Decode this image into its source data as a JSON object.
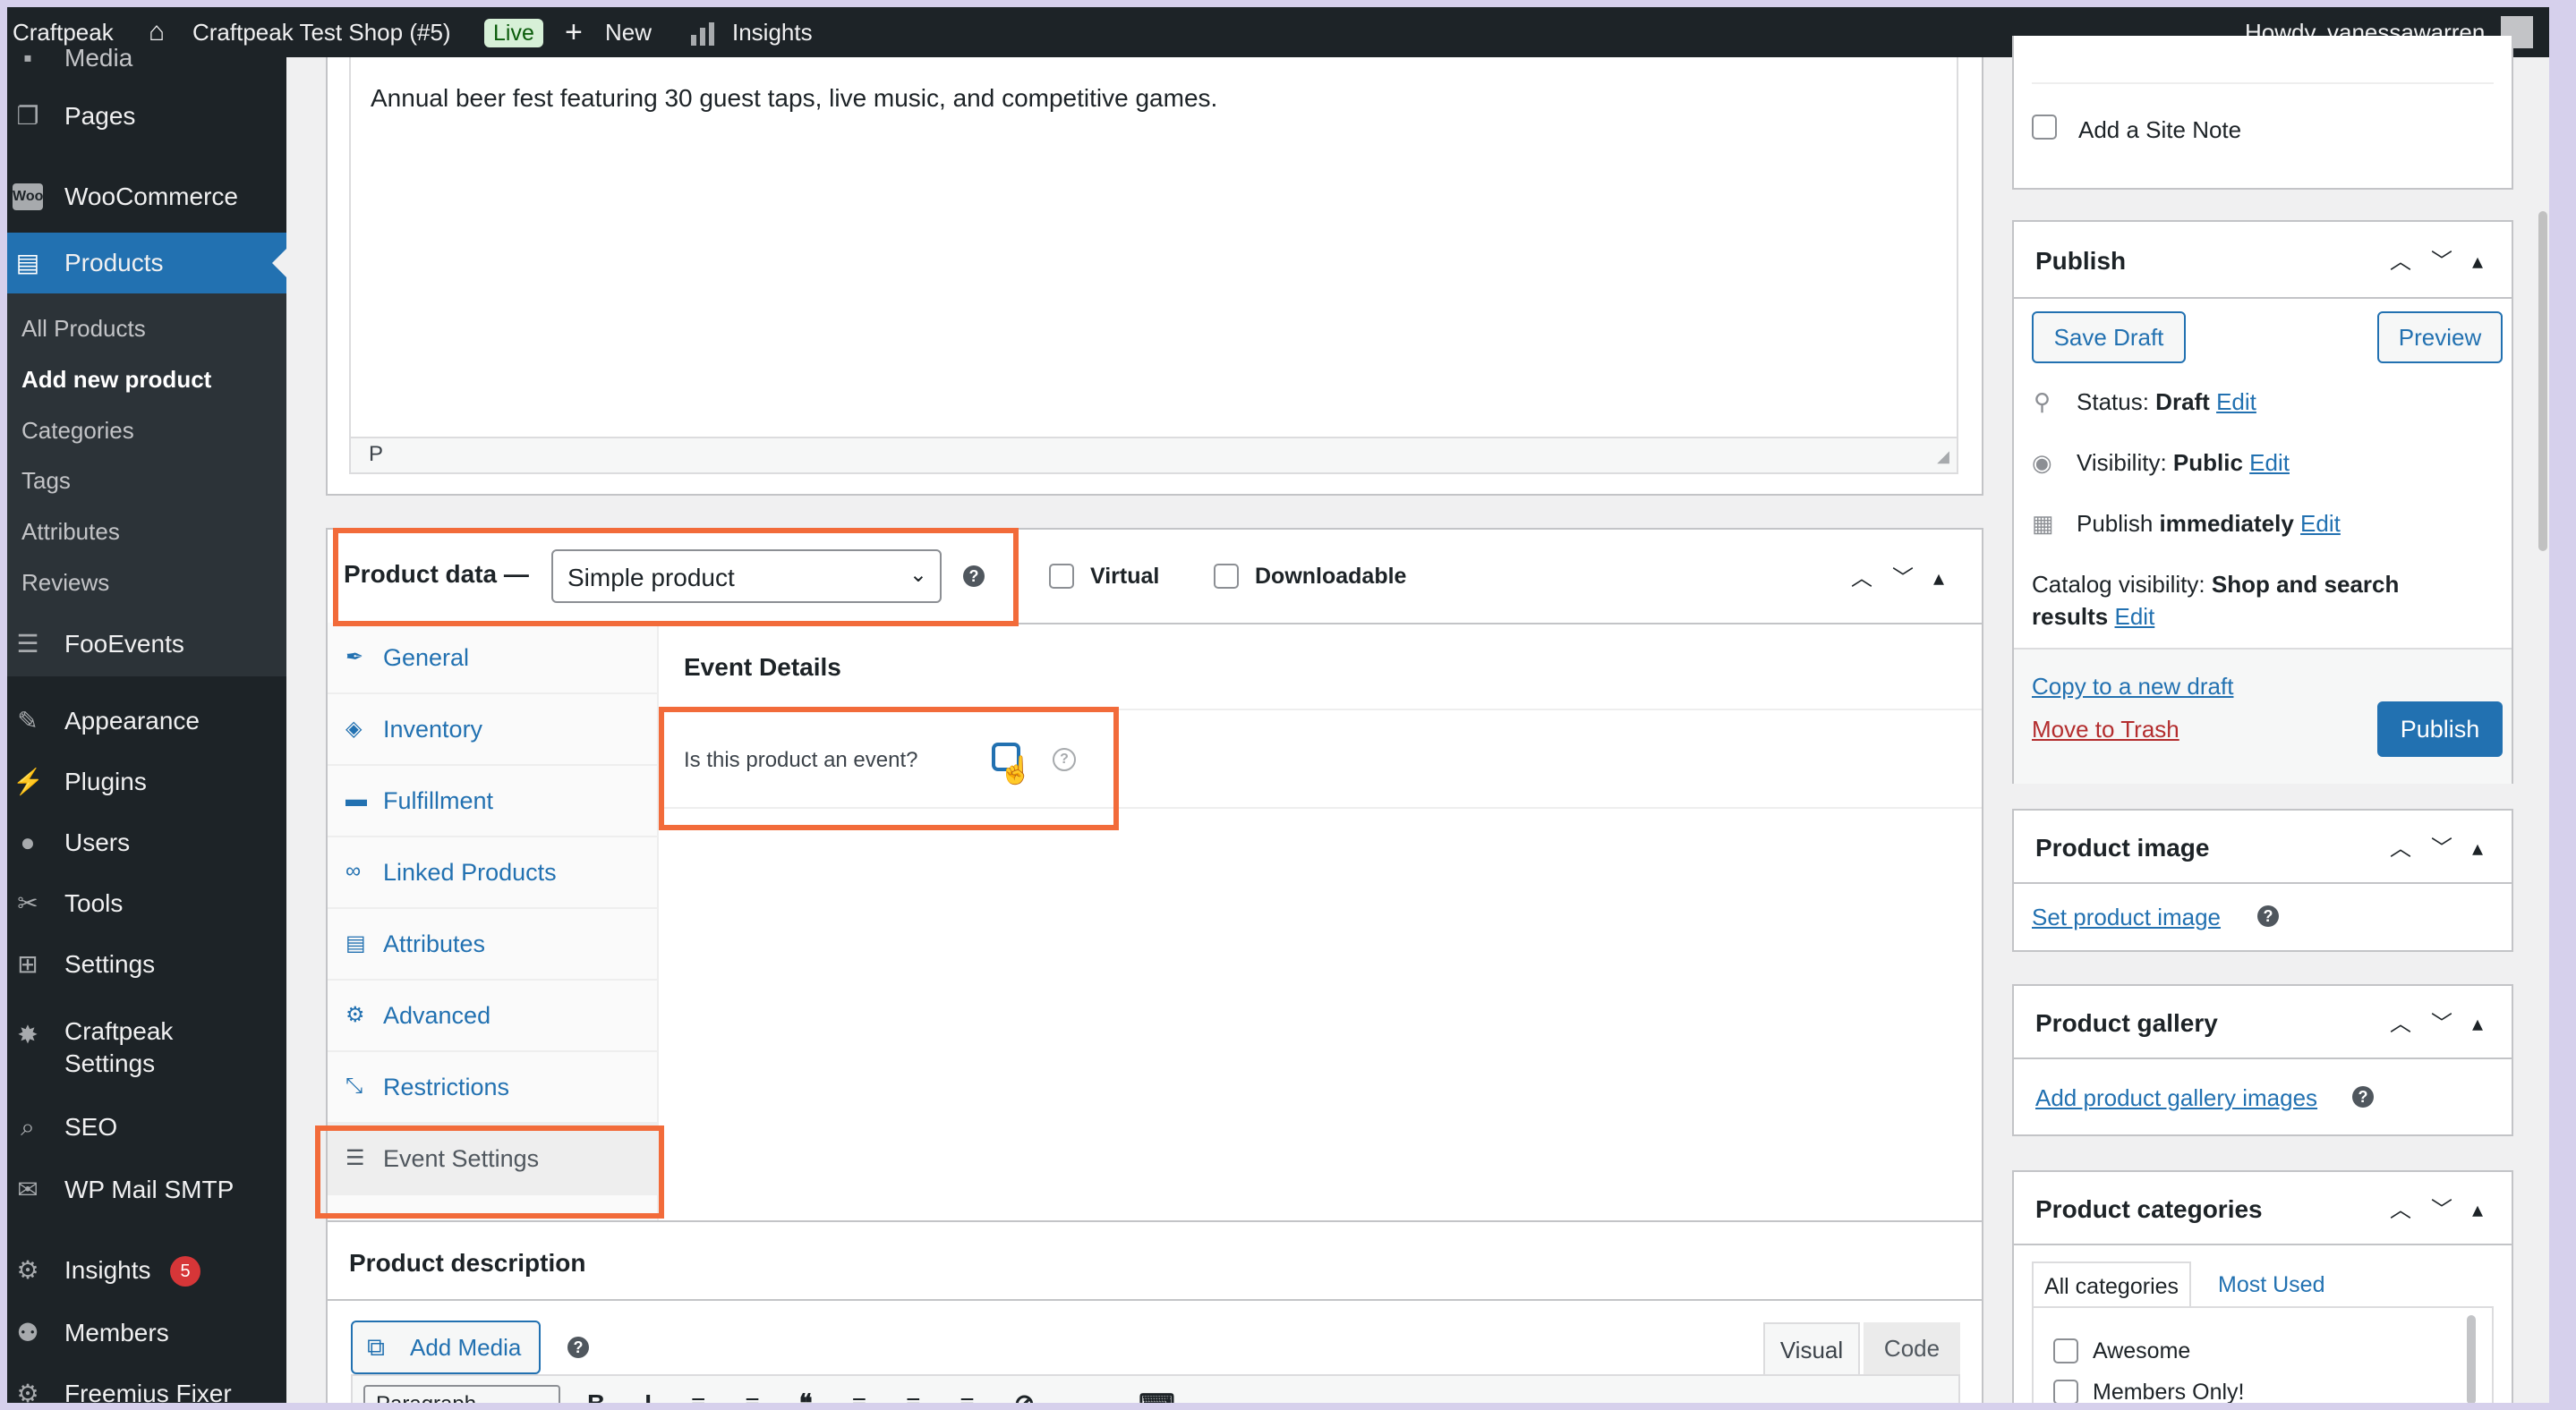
{
  "admin_bar": {
    "site_name": "Craftpeak",
    "shop_name": "Craftpeak Test Shop (#5)",
    "live_badge": "Live",
    "new_label": "New",
    "insights_label": "Insights",
    "greeting": "Howdy, vanessawarren"
  },
  "sidebar": {
    "cut_item": "Media",
    "pages": "Pages",
    "woocommerce": "WooCommerce",
    "products": "Products",
    "submenu": [
      "All Products",
      "Add new product",
      "Categories",
      "Tags",
      "Attributes",
      "Reviews"
    ],
    "fooevents": "FooEvents",
    "appearance": "Appearance",
    "plugins": "Plugins",
    "users": "Users",
    "tools": "Tools",
    "settings": "Settings",
    "craftpeak_settings_1": "Craftpeak",
    "craftpeak_settings_2": "Settings",
    "seo": "SEO",
    "wp_mail_smtp": "WP Mail SMTP",
    "insights": "Insights",
    "insights_badge": "5",
    "members": "Members",
    "freemius_fixer": "Freemius Fixer"
  },
  "editor": {
    "content_text": "Annual beer fest featuring 30 guest taps, live music, and competitive games.",
    "path_label": "P"
  },
  "product_data": {
    "label": "Product data —",
    "type_selected": "Simple product",
    "virtual_label": "Virtual",
    "downloadable_label": "Downloadable",
    "tabs": [
      "General",
      "Inventory",
      "Fulfillment",
      "Linked Products",
      "Attributes",
      "Advanced",
      "Restrictions",
      "Event Settings"
    ],
    "event_details_title": "Event Details",
    "is_event_label": "Is this product an event?"
  },
  "product_description": {
    "title": "Product description",
    "add_media": "Add Media",
    "visual_tab": "Visual",
    "code_tab": "Code",
    "format_select": "Paragraph"
  },
  "right": {
    "site_note_label": "Add a Site Note",
    "publish": {
      "title": "Publish",
      "save_draft": "Save Draft",
      "preview": "Preview",
      "status_label": "Status:",
      "status_value": "Draft",
      "visibility_label": "Visibility:",
      "visibility_value": "Public",
      "publish_label": "Publish",
      "publish_value": "immediately",
      "catalog_label": "Catalog visibility:",
      "catalog_value_1": "Shop and search",
      "catalog_value_2": "results",
      "edit": "Edit",
      "copy_draft": "Copy to a new draft",
      "move_trash": "Move to Trash",
      "publish_button": "Publish"
    },
    "product_image": {
      "title": "Product image",
      "link": "Set product image"
    },
    "product_gallery": {
      "title": "Product gallery",
      "link": "Add product gallery images"
    },
    "product_categories": {
      "title": "Product categories",
      "tab_all": "All categories",
      "tab_most": "Most Used",
      "items": [
        "Awesome",
        "Members Only!"
      ]
    }
  },
  "colors": {
    "accent": "#2271b1",
    "highlight": "#f26b3a",
    "admin_dark": "#1d2327",
    "trash": "#b32d2e"
  }
}
